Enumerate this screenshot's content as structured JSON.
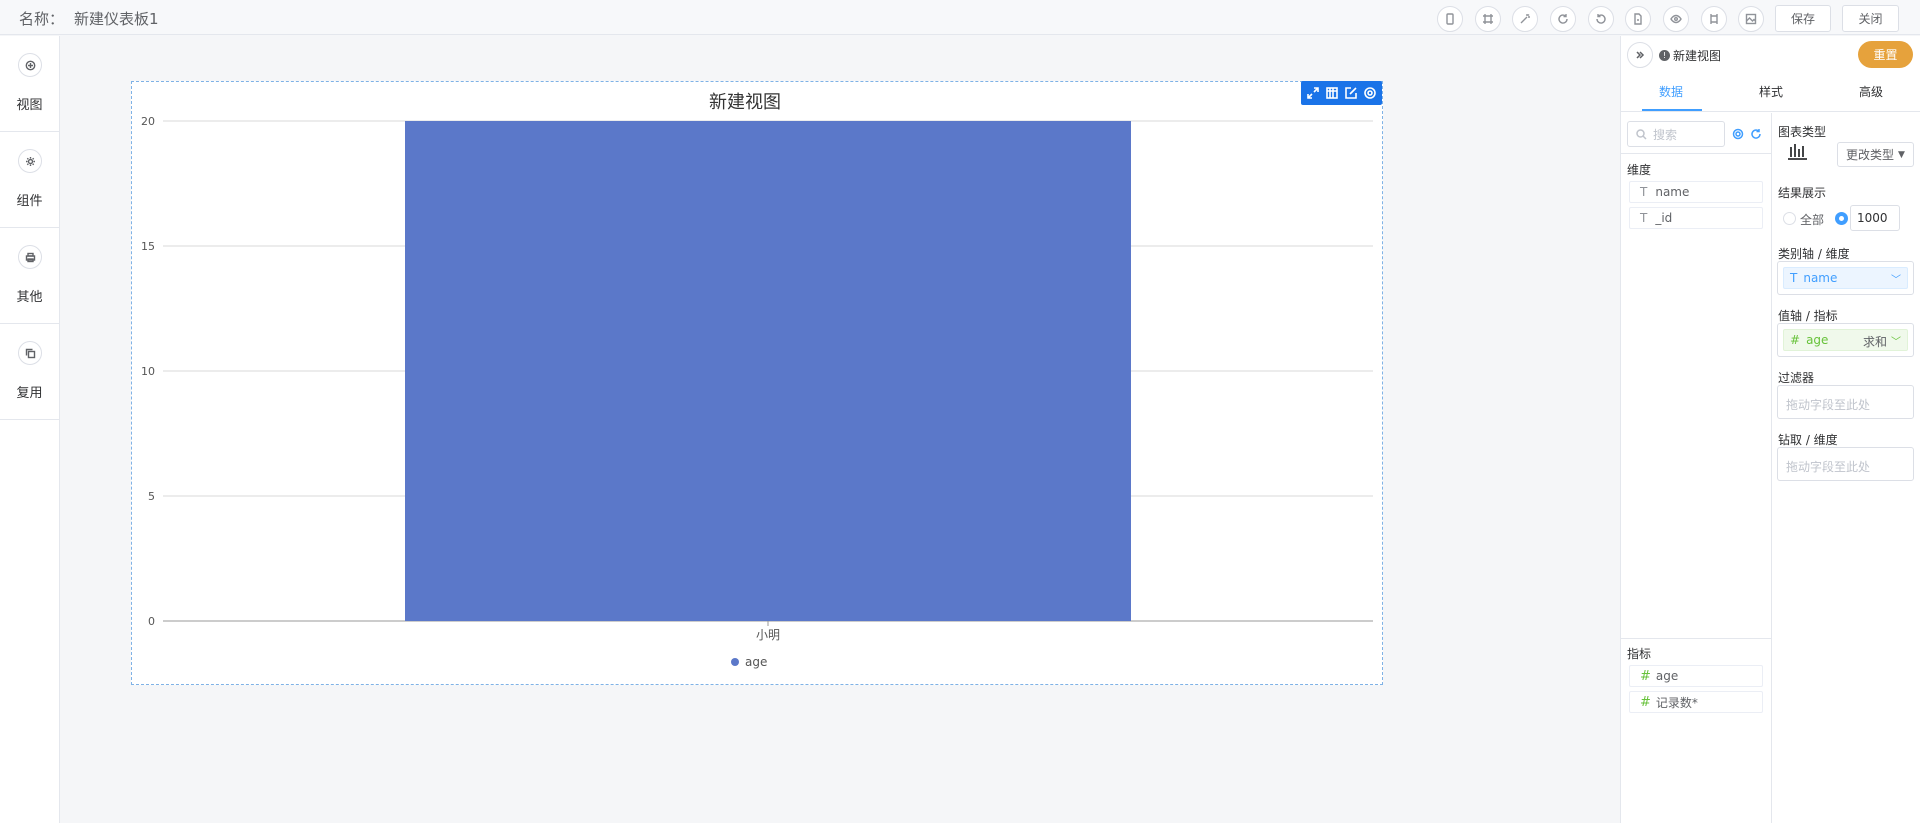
{
  "header": {
    "name_label": "名称：",
    "dashboard_name": "新建仪表板1",
    "save_label": "保存",
    "close_label": "关闭"
  },
  "sidebar": {
    "items": [
      {
        "label": "视图",
        "icon": "plus-circle-icon"
      },
      {
        "label": "组件",
        "icon": "gear-icon"
      },
      {
        "label": "其他",
        "icon": "printer-icon"
      },
      {
        "label": "复用",
        "icon": "copy-icon"
      }
    ]
  },
  "panel": {
    "view_name": "新建视图",
    "reset_label": "重置",
    "tabs": [
      "数据",
      "样式",
      "高级"
    ],
    "search_placeholder": "搜索",
    "dimension_label": "维度",
    "dimensions": [
      "name",
      "_id"
    ],
    "measure_label": "指标",
    "measures": [
      "age",
      "记录数*"
    ],
    "chart_type_label": "图表类型",
    "change_type_label": "更改类型",
    "result_label": "结果展示",
    "result_all": "全部",
    "result_limit": "1000",
    "category_axis_label": "类别轴 / 维度",
    "category_field": "name",
    "value_axis_label": "值轴 / 指标",
    "value_field": "age",
    "value_agg": "求和",
    "filter_label": "过滤器",
    "filter_placeholder": "拖动字段至此处",
    "drill_label": "钻取 / 维度",
    "drill_placeholder": "拖动字段至此处"
  },
  "chart_data": {
    "type": "bar",
    "title": "新建视图",
    "categories": [
      "小明"
    ],
    "series": [
      {
        "name": "age",
        "values": [
          20
        ],
        "color": "#5b78c9"
      }
    ],
    "ylim": [
      0,
      20
    ],
    "yticks": [
      0,
      5,
      10,
      15,
      20
    ],
    "grid": true,
    "legend": "bottom-center"
  }
}
